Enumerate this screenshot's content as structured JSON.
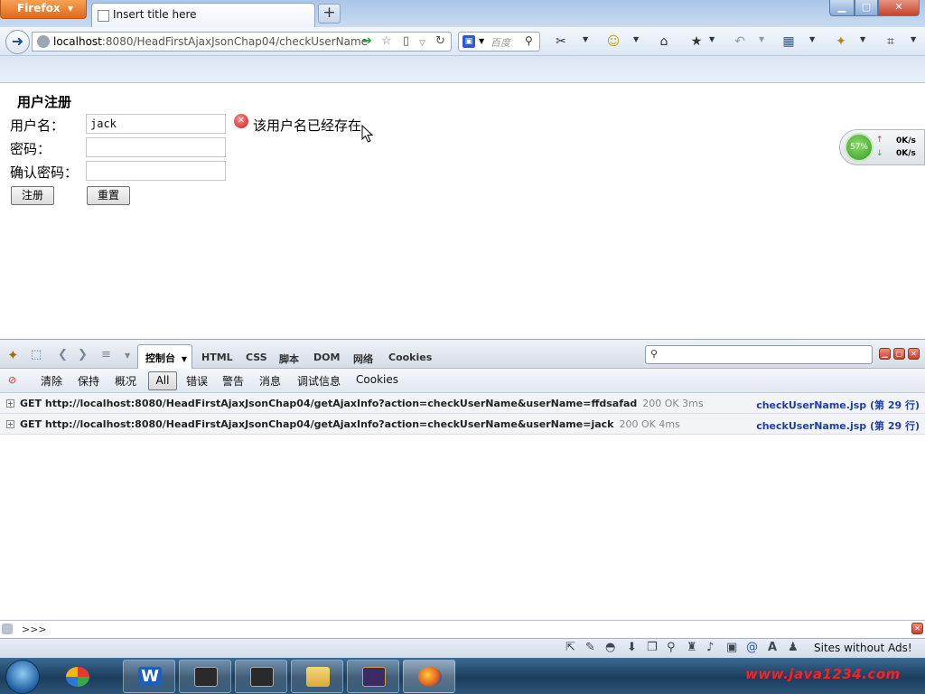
{
  "browser": {
    "menu_label": "Firefox",
    "tab_title": "Insert title here",
    "new_tab_symbol": "+",
    "url_host": "localhost",
    "url_rest": ":8080/HeadFirstAjaxJsonChap04/checkUserName",
    "search_placeholder": "百度",
    "icons": [
      "back-arrow-icon",
      "globe-icon",
      "go-arrow-icon",
      "star-icon",
      "reload-icon",
      "search-engine-icon",
      "home-icon"
    ]
  },
  "form": {
    "title": "用户注册",
    "username_label": "用户名：",
    "username_value": "jack",
    "password_label": "密码：",
    "password_value": "",
    "confirm_label": "确认密码：",
    "confirm_value": "",
    "register_button": "注册",
    "reset_button": "重置",
    "error_message": "该用户名已经存在"
  },
  "netmon": {
    "percent": "57%",
    "up": "0K/s",
    "down": "0K/s"
  },
  "firebug": {
    "tabs": {
      "console": "控制台",
      "html": "HTML",
      "css": "CSS",
      "script": "脚本",
      "dom": "DOM",
      "net": "网络",
      "cookies": "Cookies"
    },
    "filters": {
      "clear": "清除",
      "persist": "保持",
      "profile": "概况",
      "all": "All",
      "errors": "错误",
      "warnings": "警告",
      "info": "消息",
      "debug": "调试信息",
      "cookies": "Cookies"
    },
    "requests": [
      {
        "text": "GET http://localhost:8080/HeadFirstAjaxJsonChap04/getAjaxInfo?action=checkUserName&userName=ffdsafad",
        "status": "200 OK 3ms",
        "source": "checkUserName.jsp (第 29 行)"
      },
      {
        "text": "GET http://localhost:8080/HeadFirstAjaxJsonChap04/getAjaxInfo?action=checkUserName&userName=jack",
        "status": "200 OK 4ms",
        "source": "checkUserName.jsp (第 29 行)"
      }
    ],
    "prompt": ">>>"
  },
  "addon_bar": {
    "text": "Sites without Ads!"
  },
  "taskbar": {
    "watermark": "www.java1234.com"
  },
  "colors": {
    "firefox_orange": "#e1681c",
    "error_red": "#d01c1c",
    "link_blue": "#1e3fa8"
  }
}
